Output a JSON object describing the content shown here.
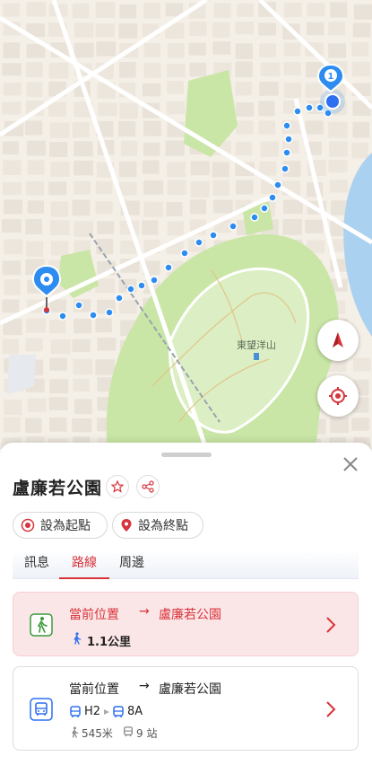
{
  "map": {
    "landmark_label": "東望洋山",
    "start_marker_number": "1",
    "route_color": "#2d8cf0",
    "park_color": "#c6e6a5",
    "road_color": "#ffffff",
    "block_color": "#f2ede6"
  },
  "controls": {
    "compass": "compass-icon",
    "locate": "locate-icon"
  },
  "place": {
    "title": "盧廉若公園",
    "set_start_label": "設為起點",
    "set_end_label": "設為終點"
  },
  "tabs": [
    {
      "label": "訊息",
      "active": false
    },
    {
      "label": "路線",
      "active": true
    },
    {
      "label": "周邊",
      "active": false
    }
  ],
  "routes": {
    "walk": {
      "from": "當前位置",
      "arrow": "→",
      "to": "盧廉若公園",
      "distance": "1.1公里"
    },
    "bus": {
      "from": "當前位置",
      "arrow": "→",
      "to": "盧廉若公園",
      "line1": "H2",
      "line2": "8A",
      "walk": "545米",
      "stops": "9 站"
    }
  },
  "colors": {
    "accent": "#d8333a",
    "highlight_bg": "#fbe6e7"
  }
}
